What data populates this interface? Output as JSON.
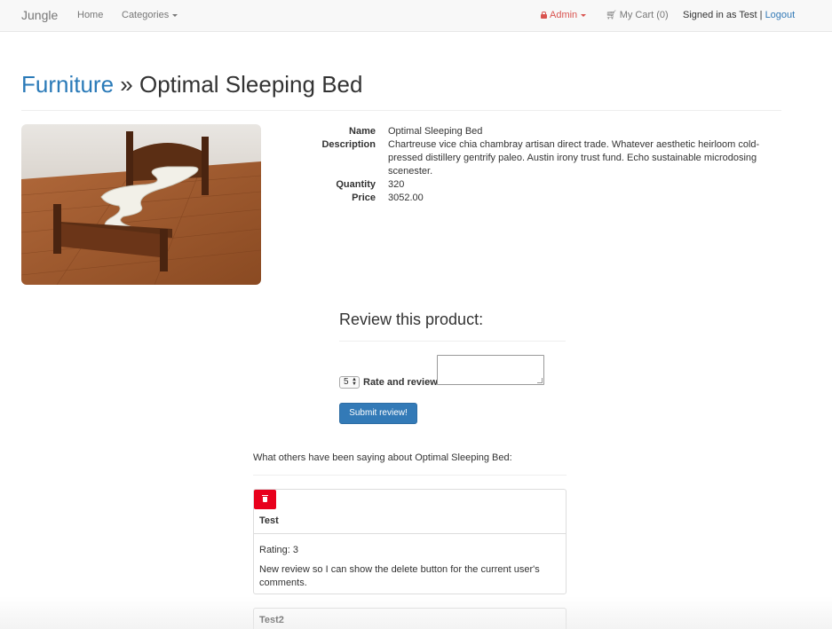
{
  "navbar": {
    "brand": "Jungle",
    "home": "Home",
    "categories": "Categories",
    "admin": "Admin",
    "cart": "My Cart (0)",
    "signed_in": "Signed in as Test",
    "separator": "|",
    "logout": "Logout"
  },
  "page": {
    "category": "Furniture",
    "separator": "»",
    "product_name": "Optimal Sleeping Bed"
  },
  "details": {
    "name_label": "Name",
    "name_value": "Optimal Sleeping Bed",
    "description_label": "Description",
    "description_value": "Chartreuse vice chia chambray artisan direct trade. Whatever aesthetic heirloom cold-pressed distillery gentrify paleo. Austin irony trust fund. Echo sustainable microdosing scenester.",
    "quantity_label": "Quantity",
    "quantity_value": "320",
    "price_label": "Price",
    "price_value": "3052.00"
  },
  "review_form": {
    "title": "Review this product:",
    "rating_selected": "5",
    "rate_label": "Rate and review",
    "submit": "Submit review!"
  },
  "reviews": {
    "intro": "What others have been saying about Optimal Sleeping Bed:",
    "items": [
      {
        "user": "Test",
        "rating": "Rating: 3",
        "comment": "New review so I can show the delete button for the current user's comments."
      },
      {
        "user": "Test2"
      }
    ]
  },
  "colors": {
    "link_blue": "#2a7ab8",
    "primary_button": "#337ab7",
    "delete_button": "#e8001c",
    "admin_red": "#d9534f"
  },
  "icons": [
    "lock-icon",
    "cart-icon",
    "trash-icon",
    "caret-down-icon"
  ]
}
